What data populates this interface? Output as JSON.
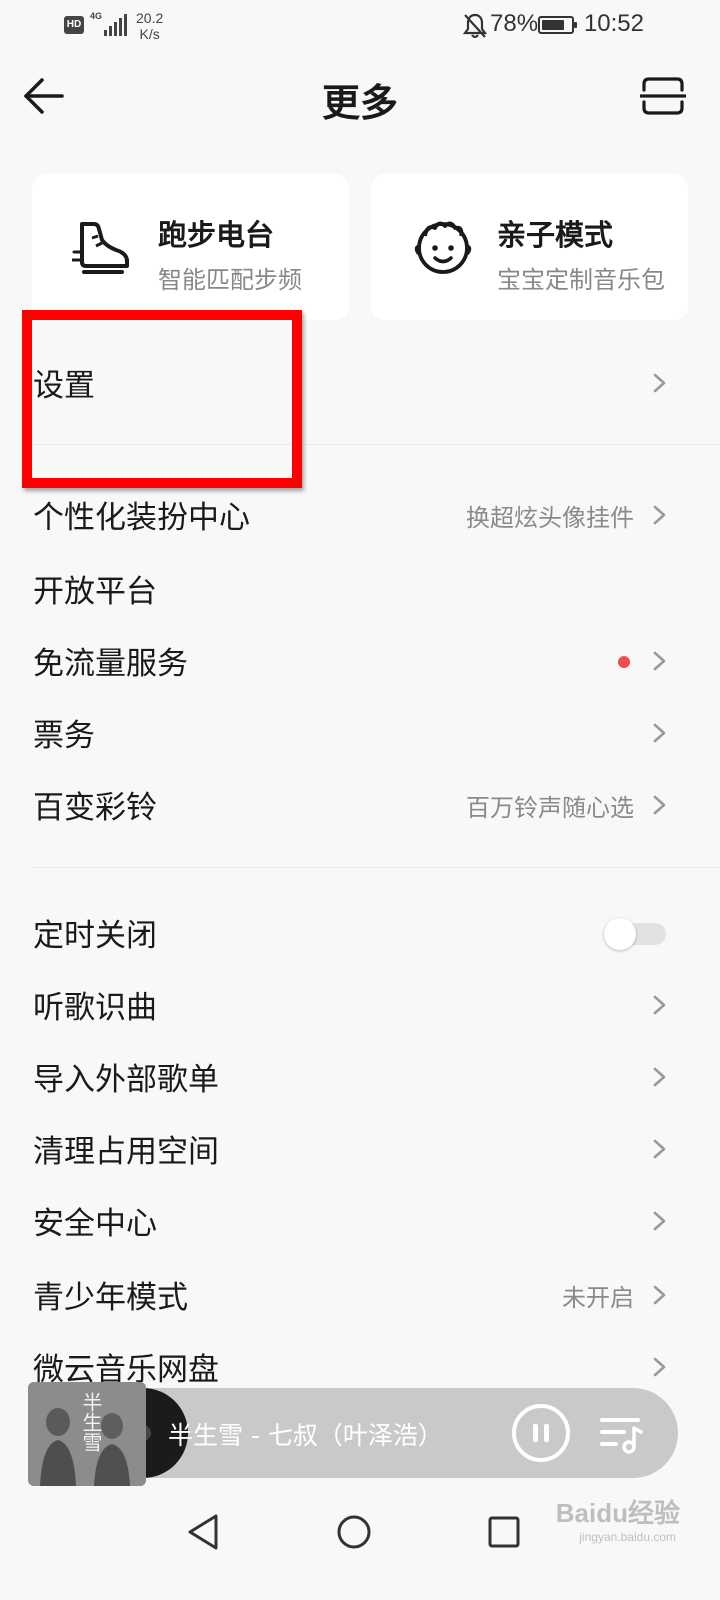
{
  "status_bar": {
    "hd": "HD",
    "network": "4G",
    "speed_value": "20.2",
    "speed_unit": "K/s",
    "battery": "78%",
    "battery_level": 0.78,
    "time": "10:52"
  },
  "header": {
    "title": "更多"
  },
  "cards": [
    {
      "title": "跑步电台",
      "subtitle": "智能匹配步频",
      "icon": "running-shoe-icon"
    },
    {
      "title": "亲子模式",
      "subtitle": "宝宝定制音乐包",
      "icon": "baby-face-icon"
    }
  ],
  "settings": {
    "label": "设置"
  },
  "group1": [
    {
      "label": "个性化装扮中心",
      "value": "换超炫头像挂件",
      "chevron": true
    },
    {
      "label": "开放平台",
      "value": "",
      "chevron": false
    },
    {
      "label": "免流量服务",
      "value": "",
      "chevron": true,
      "red_dot": true
    },
    {
      "label": "票务",
      "value": "",
      "chevron": true
    },
    {
      "label": "百变彩铃",
      "value": "百万铃声随心选",
      "chevron": true
    }
  ],
  "group2": [
    {
      "label": "定时关闭",
      "toggle": false
    },
    {
      "label": "听歌识曲",
      "value": ""
    },
    {
      "label": "导入外部歌单",
      "value": ""
    },
    {
      "label": "清理占用空间",
      "value": ""
    },
    {
      "label": "安全中心",
      "value": ""
    },
    {
      "label": "青少年模式",
      "value": "未开启"
    },
    {
      "label": "微云音乐网盘",
      "value": ""
    }
  ],
  "player": {
    "track": "半生雪 - 七叔（叶泽浩）",
    "cover_text": "半生雪"
  },
  "watermark": {
    "brand": "Baidu经验",
    "url": "jingyan.baidu.com"
  },
  "colors": {
    "accent_red": "#ff0000",
    "dot_red": "#f04d4d",
    "background": "#f8f8f8"
  }
}
